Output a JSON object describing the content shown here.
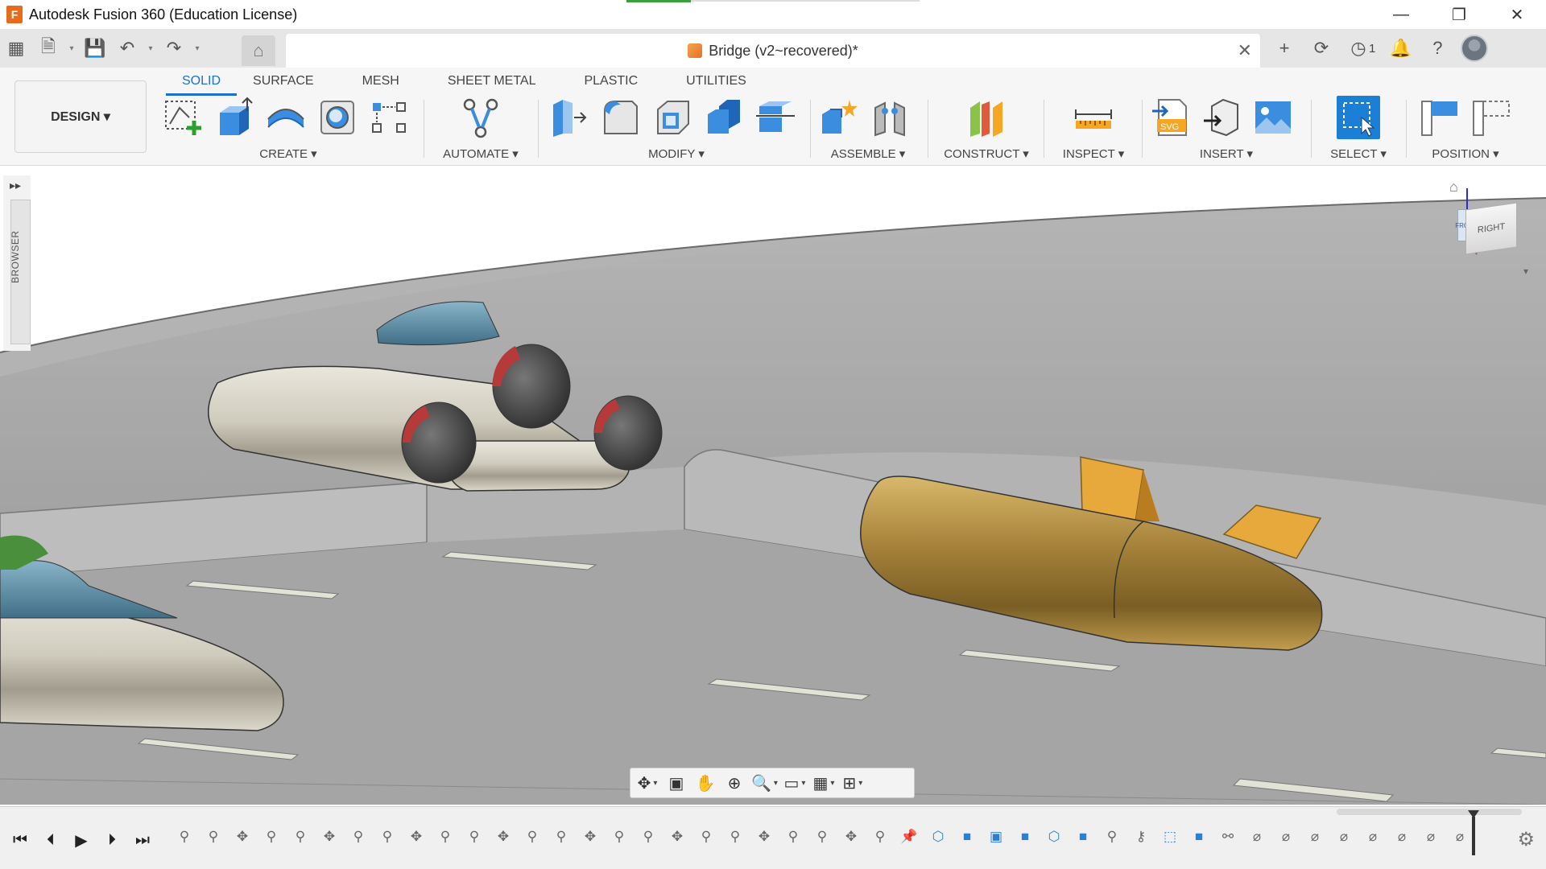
{
  "app": {
    "title": "Autodesk Fusion 360 (Education License)",
    "logo_letter": "F"
  },
  "window_controls": {
    "minimize": "—",
    "restore": "❐",
    "close": "✕"
  },
  "document": {
    "tab_title": "Bridge (v2~recovered)*",
    "close": "✕"
  },
  "quick_access": {
    "grid": "▦",
    "file": "🗎",
    "save": "💾",
    "undo": "↶",
    "redo": "↷",
    "dropdown": "▾",
    "home": "⌂"
  },
  "top_right": {
    "new_tab": "+",
    "online": "⟳",
    "jobs": "◷",
    "jobs_count": "1",
    "notifications": "🔔",
    "help": "?"
  },
  "ribbon": {
    "workspace": "DESIGN ▾",
    "tabs": [
      "SOLID",
      "SURFACE",
      "MESH",
      "SHEET METAL",
      "PLASTIC",
      "UTILITIES"
    ],
    "active_tab": "SOLID",
    "groups": {
      "create": "CREATE ▾",
      "automate": "AUTOMATE ▾",
      "modify": "MODIFY ▾",
      "assemble": "ASSEMBLE ▾",
      "construct": "CONSTRUCT ▾",
      "inspect": "INSPECT ▾",
      "insert": "INSERT ▾",
      "select": "SELECT ▾",
      "position": "POSITION ▾"
    },
    "accent": "#1b6fd1"
  },
  "browser": {
    "label": "BROWSER",
    "expand": "▸▸"
  },
  "viewcube": {
    "right_label": "RIGHT",
    "front_label": "FRONT",
    "home": "⌂",
    "menu": "▾"
  },
  "navbar": {
    "orbit": "✥",
    "look": "▣",
    "pan": "✋",
    "zoom_window": "⊕",
    "zoom": "🔍",
    "display": "▭",
    "grid": "▦",
    "viewports": "⊞",
    "caret": "▾"
  },
  "timeline": {
    "first": "⏮",
    "prev": "⏴",
    "play": "▶",
    "next": "⏵",
    "last": "⏭",
    "gear": "⚙",
    "items": [
      {
        "glyph": "⚲",
        "kind": "sketch"
      },
      {
        "glyph": "⚲",
        "kind": "sketch"
      },
      {
        "glyph": "✥",
        "kind": "wire"
      },
      {
        "glyph": "⚲",
        "kind": "sketch"
      },
      {
        "glyph": "⚲",
        "kind": "sketch"
      },
      {
        "glyph": "✥",
        "kind": "wire"
      },
      {
        "glyph": "⚲",
        "kind": "sketch"
      },
      {
        "glyph": "⚲",
        "kind": "sketch"
      },
      {
        "glyph": "✥",
        "kind": "wire"
      },
      {
        "glyph": "⚲",
        "kind": "sketch"
      },
      {
        "glyph": "⚲",
        "kind": "sketch"
      },
      {
        "glyph": "✥",
        "kind": "wire"
      },
      {
        "glyph": "⚲",
        "kind": "sketch"
      },
      {
        "glyph": "⚲",
        "kind": "sketch"
      },
      {
        "glyph": "✥",
        "kind": "wire"
      },
      {
        "glyph": "⚲",
        "kind": "sketch"
      },
      {
        "glyph": "⚲",
        "kind": "sketch"
      },
      {
        "glyph": "✥",
        "kind": "wire"
      },
      {
        "glyph": "⚲",
        "kind": "sketch"
      },
      {
        "glyph": "⚲",
        "kind": "sketch"
      },
      {
        "glyph": "✥",
        "kind": "wire"
      },
      {
        "glyph": "⚲",
        "kind": "sketch"
      },
      {
        "glyph": "⚲",
        "kind": "sketch"
      },
      {
        "glyph": "✥",
        "kind": "wire"
      },
      {
        "glyph": "⚲",
        "kind": "sketch"
      },
      {
        "glyph": "📌",
        "kind": "wire"
      },
      {
        "glyph": "⬡",
        "kind": "feat"
      },
      {
        "glyph": "■",
        "kind": "feat"
      },
      {
        "glyph": "▣",
        "kind": "feat"
      },
      {
        "glyph": "■",
        "kind": "feat"
      },
      {
        "glyph": "⬡",
        "kind": "feat"
      },
      {
        "glyph": "■",
        "kind": "feat"
      },
      {
        "glyph": "⚲",
        "kind": "sketch"
      },
      {
        "glyph": "⚷",
        "kind": "wire"
      },
      {
        "glyph": "⬚",
        "kind": "feat"
      },
      {
        "glyph": "■",
        "kind": "feat"
      },
      {
        "glyph": "⚯",
        "kind": "wire"
      },
      {
        "glyph": "⌀",
        "kind": "wire"
      },
      {
        "glyph": "⌀",
        "kind": "wire"
      },
      {
        "glyph": "⌀",
        "kind": "wire"
      },
      {
        "glyph": "⌀",
        "kind": "wire"
      },
      {
        "glyph": "⌀",
        "kind": "wire"
      },
      {
        "glyph": "⌀",
        "kind": "wire"
      },
      {
        "glyph": "⌀",
        "kind": "wire"
      },
      {
        "glyph": "⌀",
        "kind": "wire"
      }
    ]
  }
}
